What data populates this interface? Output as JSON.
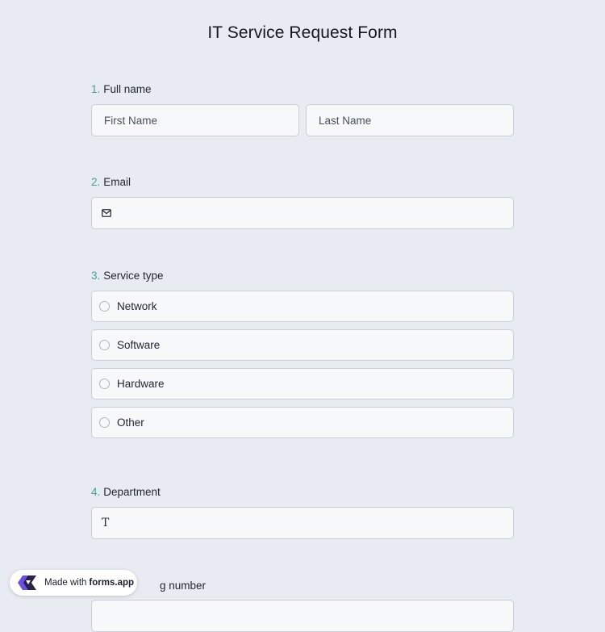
{
  "form": {
    "title": "IT Service Request Form"
  },
  "questions": {
    "q1": {
      "num": "1.",
      "label": "Full name",
      "first_placeholder": "First Name",
      "last_placeholder": "Last Name"
    },
    "q2": {
      "num": "2.",
      "label": "Email",
      "icon": "envelope-icon"
    },
    "q3": {
      "num": "3.",
      "label": "Service type",
      "options": [
        "Network",
        "Software",
        "Hardware",
        "Other"
      ]
    },
    "q4": {
      "num": "4.",
      "label": "Department",
      "icon": "text-icon",
      "icon_glyph": "T"
    },
    "q5": {
      "label_partial": "g number"
    }
  },
  "badge": {
    "made_with": "Made with",
    "brand": "forms.app",
    "icon": "forms-app-logo-icon"
  },
  "colors": {
    "background": "#e8ebf1",
    "field_bg": "#f7f8fa",
    "border": "#c9ced7",
    "accent_number": "#4d9b95",
    "logo_purple": "#6c4fe0"
  }
}
